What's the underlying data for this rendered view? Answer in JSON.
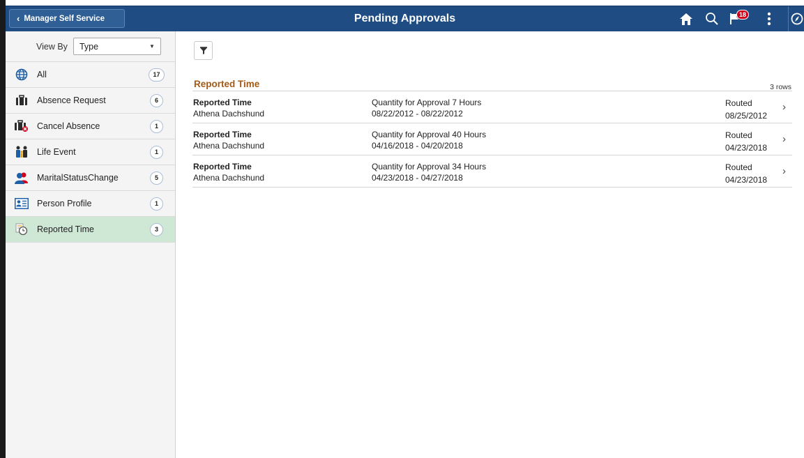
{
  "header": {
    "back_label": "Manager Self Service",
    "title": "Pending Approvals",
    "notification_count": "18"
  },
  "sidebar": {
    "view_by_label": "View By",
    "view_by_value": "Type",
    "items": [
      {
        "label": "All",
        "count": "17",
        "icon": "globe-icon"
      },
      {
        "label": "Absence Request",
        "count": "6",
        "icon": "briefcase-icon"
      },
      {
        "label": "Cancel Absence",
        "count": "1",
        "icon": "briefcase-cancel-icon"
      },
      {
        "label": "Life Event",
        "count": "1",
        "icon": "family-icon"
      },
      {
        "label": "MaritalStatusChange",
        "count": "5",
        "icon": "people-icon"
      },
      {
        "label": "Person Profile",
        "count": "1",
        "icon": "profile-card-icon"
      },
      {
        "label": "Reported Time",
        "count": "3",
        "icon": "timesheet-clock-icon"
      }
    ],
    "active_index": 6
  },
  "main": {
    "section_title": "Reported Time",
    "rows_count": "3 rows",
    "rows": [
      {
        "type": "Reported Time",
        "name": "Athena Dachshund",
        "quantity": "Quantity for Approval 7 Hours",
        "dates": "08/22/2012 - 08/22/2012",
        "status": "Routed",
        "date": "08/25/2012"
      },
      {
        "type": "Reported Time",
        "name": "Athena Dachshund",
        "quantity": "Quantity for Approval 40 Hours",
        "dates": "04/16/2018 - 04/20/2018",
        "status": "Routed",
        "date": "04/23/2018"
      },
      {
        "type": "Reported Time",
        "name": "Athena Dachshund",
        "quantity": "Quantity for Approval 34 Hours",
        "dates": "04/23/2018 - 04/27/2018",
        "status": "Routed",
        "date": "04/23/2018"
      }
    ]
  },
  "colors": {
    "header_bg": "#1f4c82",
    "active_item_bg": "#cfe8d6",
    "section_title": "#a25a16",
    "badge": "#d0021b"
  }
}
